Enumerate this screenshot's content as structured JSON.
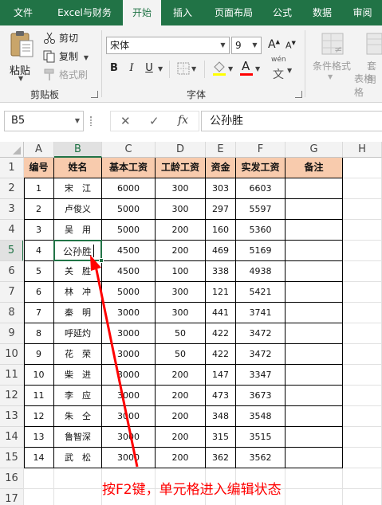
{
  "ribbon_tabs": [
    "文件",
    "Excel与财务",
    "开始",
    "插入",
    "页面布局",
    "公式",
    "数据",
    "审阅"
  ],
  "active_tab": "开始",
  "clipboard": {
    "paste": "粘贴",
    "cut": "剪切",
    "copy": "复制",
    "format_painter": "格式刷",
    "group_label": "剪贴板"
  },
  "font": {
    "name": "宋体",
    "size": "9",
    "bold": "B",
    "italic": "I",
    "underline": "U",
    "font_color_glyph": "A",
    "phonetic": "wén",
    "group_label": "字体",
    "font_color": "#ff0000"
  },
  "styles": {
    "conditional_format": "条件格式",
    "table_format_1": "套用",
    "table_format_2": "表格格"
  },
  "formula_bar": {
    "name_box": "B5",
    "cancel": "✕",
    "enter": "✓",
    "fx": "fx",
    "value": "公孙胜"
  },
  "columns": [
    "A",
    "B",
    "C",
    "D",
    "E",
    "F",
    "G",
    "H"
  ],
  "rows": [
    "1",
    "2",
    "3",
    "4",
    "5",
    "6",
    "7",
    "8",
    "9",
    "10",
    "11",
    "12",
    "13",
    "14",
    "15",
    "16",
    "17"
  ],
  "table": {
    "headers": [
      "编号",
      "姓名",
      "基本工资",
      "工龄工资",
      "资金",
      "实发工资",
      "备注"
    ],
    "records": [
      [
        "1",
        "宋　江",
        "6000",
        "300",
        "303",
        "6603",
        ""
      ],
      [
        "2",
        "卢俊义",
        "5000",
        "300",
        "297",
        "5597",
        ""
      ],
      [
        "3",
        "吴　用",
        "5000",
        "200",
        "160",
        "5360",
        ""
      ],
      [
        "4",
        "公孙胜",
        "4500",
        "200",
        "469",
        "5169",
        ""
      ],
      [
        "5",
        "关　胜",
        "4500",
        "100",
        "338",
        "4938",
        ""
      ],
      [
        "6",
        "林　冲",
        "5000",
        "300",
        "121",
        "5421",
        ""
      ],
      [
        "7",
        "秦　明",
        "3000",
        "300",
        "441",
        "3741",
        ""
      ],
      [
        "8",
        "呼延灼",
        "3000",
        "50",
        "422",
        "3472",
        ""
      ],
      [
        "9",
        "花　荣",
        "3000",
        "50",
        "422",
        "3472",
        ""
      ],
      [
        "10",
        "柴　进",
        "3000",
        "200",
        "147",
        "3347",
        ""
      ],
      [
        "11",
        "李　应",
        "3000",
        "200",
        "473",
        "3673",
        ""
      ],
      [
        "12",
        "朱　仝",
        "3000",
        "200",
        "348",
        "3548",
        ""
      ],
      [
        "13",
        "鲁智深",
        "3000",
        "200",
        "315",
        "3515",
        ""
      ],
      [
        "14",
        "武　松",
        "3000",
        "200",
        "362",
        "3562",
        ""
      ]
    ],
    "active_cell": "B5"
  },
  "colors": {
    "excel_green": "#217346",
    "header_fill": "#f8cbad",
    "annotation": "#ff0000"
  },
  "annotation_text": "按F2键，单元格进入编辑状态"
}
